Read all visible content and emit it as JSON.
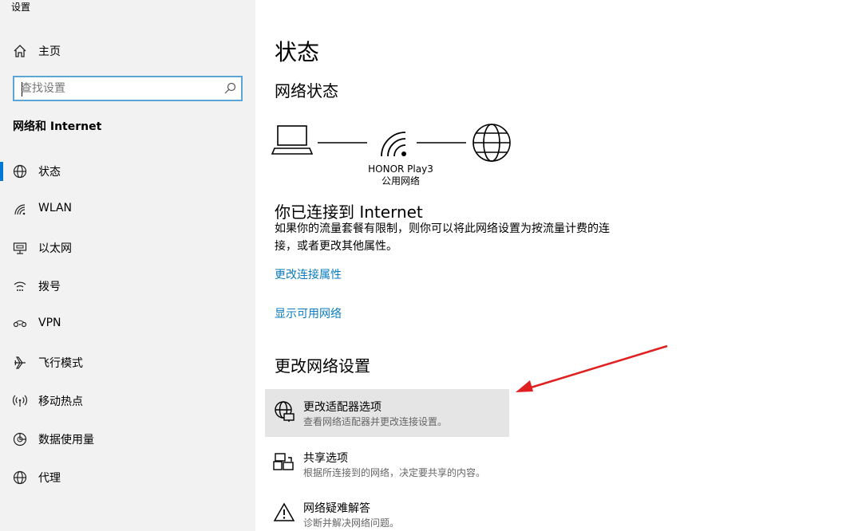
{
  "app": {
    "title": "设置"
  },
  "sidebar": {
    "home_label": "主页",
    "search_placeholder": "查找设置",
    "group_title": "网络和 Internet",
    "items": [
      {
        "label": "状态",
        "icon": "globe-icon",
        "active": true
      },
      {
        "label": "WLAN",
        "icon": "wifi-icon"
      },
      {
        "label": "以太网",
        "icon": "ethernet-icon"
      },
      {
        "label": "拨号",
        "icon": "dialup-icon"
      },
      {
        "label": "VPN",
        "icon": "vpn-icon"
      },
      {
        "label": "飞行模式",
        "icon": "airplane-icon"
      },
      {
        "label": "移动热点",
        "icon": "hotspot-icon"
      },
      {
        "label": "数据使用量",
        "icon": "data-usage-icon"
      },
      {
        "label": "代理",
        "icon": "proxy-globe-icon"
      }
    ]
  },
  "main": {
    "title": "状态",
    "network_status_title": "网络状态",
    "network_name": "HONOR Play3",
    "network_type": "公用网络",
    "connected_title": "你已连接到 Internet",
    "connected_desc": "如果你的流量套餐有限制，则你可以将此网络设置为按流量计费的连接，或者更改其他属性。",
    "link_change_props": "更改连接属性",
    "link_show_networks": "显示可用网络",
    "change_settings_title": "更改网络设置",
    "options": [
      {
        "title": "更改适配器选项",
        "subtitle": "查看网络适配器并更改连接设置。",
        "icon": "adapter-globe-icon",
        "highlighted": true
      },
      {
        "title": "共享选项",
        "subtitle": "根据所连接到的网络，决定要共享的内容。",
        "icon": "sharing-icon"
      },
      {
        "title": "网络疑难解答",
        "subtitle": "诊断并解决网络问题。",
        "icon": "warning-icon"
      }
    ]
  },
  "colors": {
    "accent": "#0078d7",
    "link": "#0a7bbd",
    "arrow": "#e02020",
    "sidebar_bg": "#f2f2f2"
  }
}
